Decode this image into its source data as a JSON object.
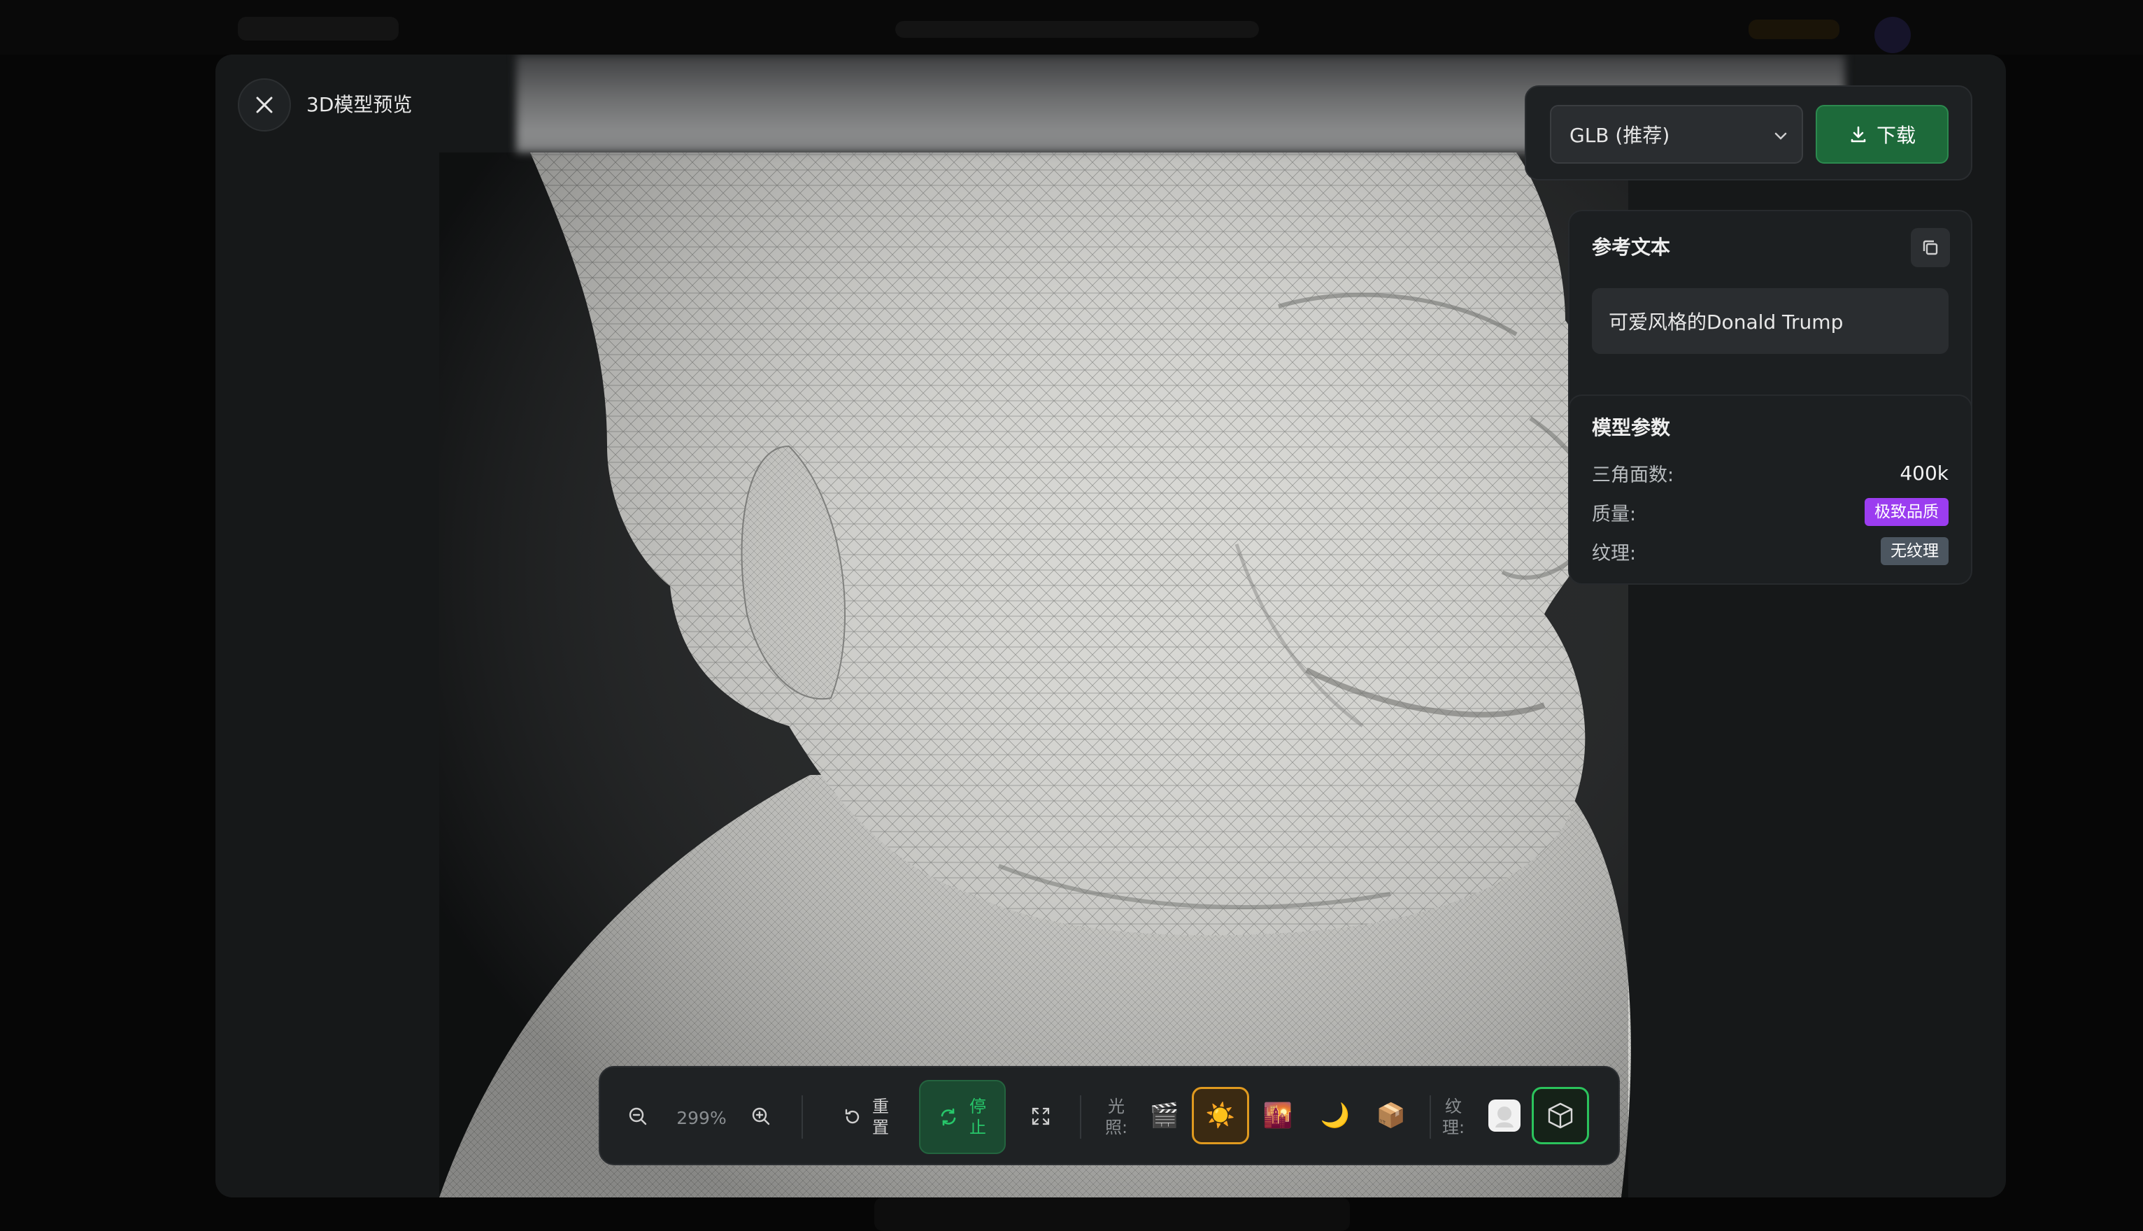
{
  "modal": {
    "title": "3D模型预览"
  },
  "export": {
    "format": "GLB (推荐)",
    "download_label": "下载"
  },
  "reference": {
    "title": "参考文本",
    "text": "可爱风格的Donald Trump"
  },
  "params": {
    "title": "模型参数",
    "rows": [
      {
        "label": "三角面数:",
        "value": "400k",
        "kind": "text"
      },
      {
        "label": "质量:",
        "value": "极致品质",
        "kind": "badge",
        "color": "#9b3df0"
      },
      {
        "label": "纹理:",
        "value": "无纹理",
        "kind": "badge",
        "color": "#4c5660"
      }
    ]
  },
  "toolbar": {
    "zoom": "299%",
    "reset_chars": [
      "重",
      "置"
    ],
    "stop_chars": [
      "停",
      "止"
    ],
    "lighting_chars": [
      "光",
      "照:"
    ],
    "texture_chars": [
      "纹",
      "理:"
    ],
    "lighting_options": [
      {
        "icon": "clapper-icon",
        "glyph": "🎬",
        "active": false
      },
      {
        "icon": "sun-icon",
        "glyph": "☀️",
        "active": true
      },
      {
        "icon": "sunset-icon",
        "glyph": "🌇",
        "active": false
      },
      {
        "icon": "moon-icon",
        "glyph": "🌙",
        "active": false
      },
      {
        "icon": "box-icon",
        "glyph": "📦",
        "active": false
      }
    ],
    "texture_options": [
      {
        "icon": "plain-model-icon",
        "active": false
      },
      {
        "icon": "wireframe-cube-icon",
        "active": true
      }
    ]
  },
  "colors": {
    "accent_green": "#27c76a",
    "accent_orange": "#e09a1f",
    "badge_purple": "#9b3df0"
  }
}
